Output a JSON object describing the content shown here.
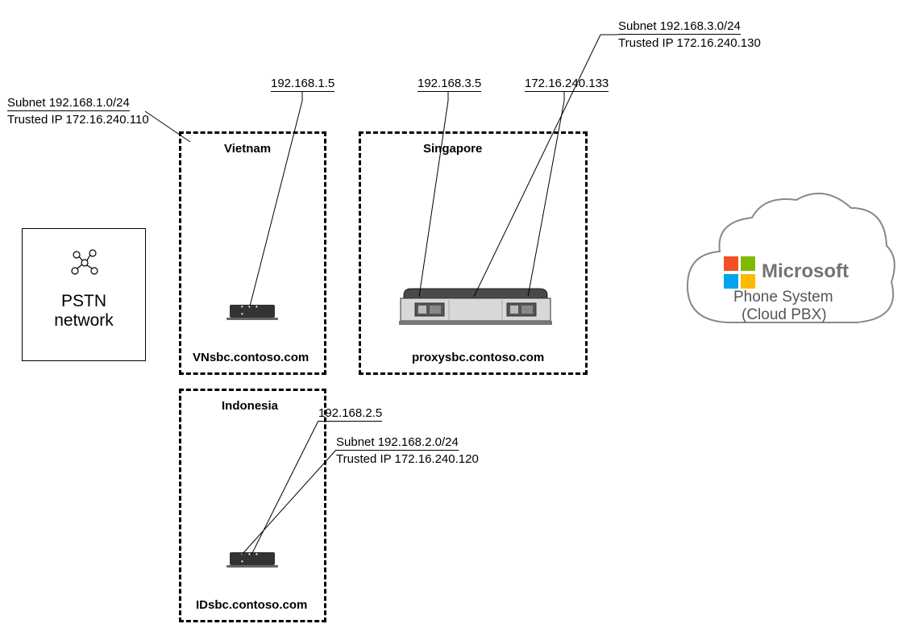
{
  "pstn": {
    "line1": "PSTN",
    "line2": "network"
  },
  "vietnam": {
    "title": "Vietnam",
    "ip": "192.168.1.5",
    "subnet": "Subnet 192.168.1.0/24",
    "trusted": "Trusted IP 172.16.240.110",
    "host": "VNsbc.contoso.com"
  },
  "singapore": {
    "title": "Singapore",
    "ip1": "192.168.3.5",
    "ip2": "172.16.240.133",
    "subnet": "Subnet 192.168.3.0/24",
    "trusted": "Trusted IP 172.16.240.130",
    "host": "proxysbc.contoso.com"
  },
  "indonesia": {
    "title": "Indonesia",
    "ip": "192.168.2.5",
    "subnet": "Subnet 192.168.2.0/24",
    "trusted": "Trusted IP 172.16.240.120",
    "host": "IDsbc.contoso.com"
  },
  "cloud": {
    "brand": "Microsoft",
    "line1": "Phone System",
    "line2": "(Cloud PBX)"
  }
}
